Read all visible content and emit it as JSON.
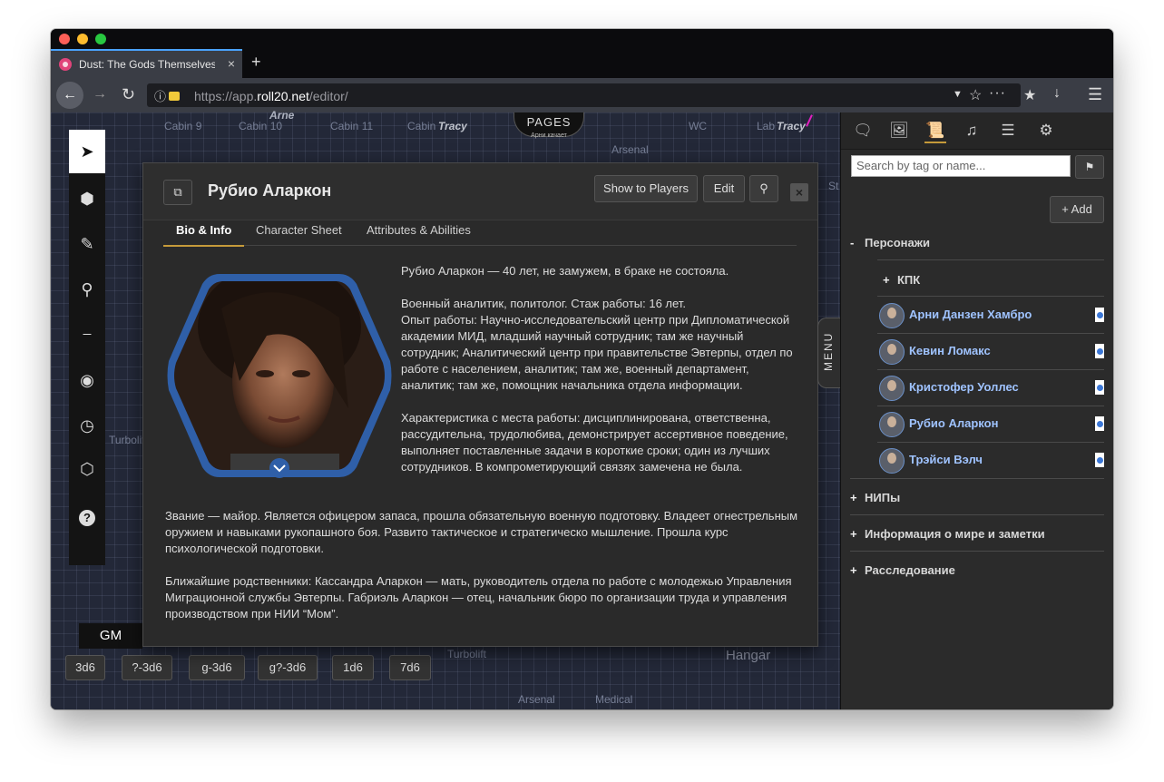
{
  "browser": {
    "tab_title": "Dust: The Gods Themselves |",
    "tab_close": "×",
    "new_tab": "+",
    "url_prefix": "https://app.",
    "url_domain": "roll20.net",
    "url_path": "/editor/"
  },
  "map": {
    "pages_label": "PAGES",
    "pages_sub": "Арни качает",
    "labels": [
      "Cabin 9",
      "Cabin 10",
      "Cabin 11",
      "Cabin",
      "Tracy",
      "WC",
      "Lab",
      "Tracy",
      "Arsenal",
      "Arne",
      "Turbolift",
      "Turbolift",
      "Hangar",
      "Arsenal",
      "Medical",
      "St"
    ]
  },
  "toolbar": {
    "gm_label": "GM",
    "tools": [
      "select-icon",
      "cube-icon",
      "brush-icon",
      "zoom-icon",
      "ruler-icon",
      "eye-icon",
      "clock-icon",
      "d20-icon",
      "help-icon"
    ]
  },
  "dice_buttons": [
    "3d6",
    "?-3d6",
    "g-3d6",
    "g?-3d6",
    "1d6",
    "7d6"
  ],
  "dialog": {
    "title": "Рубио Аларкон",
    "show_players": "Show to Players",
    "edit": "Edit",
    "close": "×",
    "tabs": [
      "Bio & Info",
      "Character Sheet",
      "Attributes & Abilities"
    ],
    "bio": [
      "Рубио Аларкон — 40 лет, не замужем, в браке не состояла.",
      "Военный аналитик, политолог. Стаж работы: 16 лет.",
      "Опыт работы: Научно-исследовательский центр при Дипломатической академии МИД, младший научный сотрудник; там же научный сотрудник; Аналитический центр при правительстве Эвтерпы, отдел по работе с населением, аналитик; там же, военный департамент, аналитик; там же, помощник начальника отдела информации.",
      "Характеристика с места работы: дисциплинирована, ответственна, рассудительна, трудолюбива, демонстрирует ассертивное поведение, выполняет поставленные задачи в короткие сроки; один из лучших сотрудников. В компрометирующий связях замечена не была.",
      "Звание — майор. Является офицером запаса, прошла обязательную военную подготовку. Владеет огнестрельным оружием и навыками рукопашного боя. Развито тактическое и стратегическо мышление. Прошла курс психологической подготовки.",
      "Ближайшие родственники: Кассандра Аларкон — мать, руководитель отдела по работе с молодежью Управления Миграционной службы Эвтерпы. Габриэль Аларкон — отец, начальник бюро по организации труда и управления производством при НИИ “Мом”."
    ]
  },
  "menu_tab": "MENU",
  "sidebar": {
    "search_placeholder": "Search by tag or name...",
    "add": "+ Add",
    "folders": [
      {
        "sym": "-",
        "label": "Персонажи"
      },
      {
        "sym": "+",
        "label": "КПК"
      },
      {
        "sym": "+",
        "label": "НИПы"
      },
      {
        "sym": "+",
        "label": "Информация о мире и заметки"
      },
      {
        "sym": "+",
        "label": "Расследование"
      }
    ],
    "characters": [
      "Арни Данзен Хамбро",
      "Кевин Ломакс",
      "Кристофер Уоллес",
      "Рубио Аларкон",
      "Трэйси Вэлч"
    ]
  },
  "colors": {
    "accent": "#c59a3a",
    "link": "#9fc3ff",
    "hex_border": "#2f5fa8",
    "tab_highlight": "#4aa3ff"
  }
}
